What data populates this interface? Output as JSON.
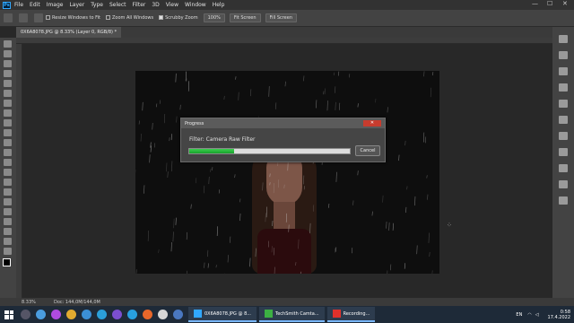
{
  "menubar": {
    "logo": "Ps",
    "items": [
      "File",
      "Edit",
      "Image",
      "Layer",
      "Type",
      "Select",
      "Filter",
      "3D",
      "View",
      "Window",
      "Help"
    ],
    "window_controls": [
      "—",
      "☐",
      "✕"
    ]
  },
  "options": {
    "resize_windows": "Resize Windows to Fit",
    "zoom_all": "Zoom All Windows",
    "scrubby_zoom": "Scrubby Zoom",
    "zoom_value": "100%",
    "fit_screen": "Fit Screen",
    "fill_screen": "Fill Screen"
  },
  "document": {
    "tab_label": "0X6A8078.JPG @ 8.33% (Layer 0, RGB/8) *"
  },
  "dialog": {
    "title": "Progress",
    "filter_label": "Filter: Camera Raw Filter",
    "progress_fraction": 0.28,
    "cancel_label": "Cancel"
  },
  "statusbar": {
    "zoom": "8.33%",
    "doc_info": "Doc: 144,0M/144,0M"
  },
  "taskbar": {
    "apps": [
      {
        "label": "0X6A8078.JPG @ 8...",
        "color": "#31a8ff"
      },
      {
        "label": "TechSmith Camta...",
        "color": "#3cb043"
      },
      {
        "label": "Recording...",
        "color": "#e0312b"
      }
    ],
    "language": "EN",
    "time": "0:58",
    "date": "17.4.2022"
  },
  "colors": {
    "accent": "#31a8ff",
    "progress": "#27b83a"
  }
}
